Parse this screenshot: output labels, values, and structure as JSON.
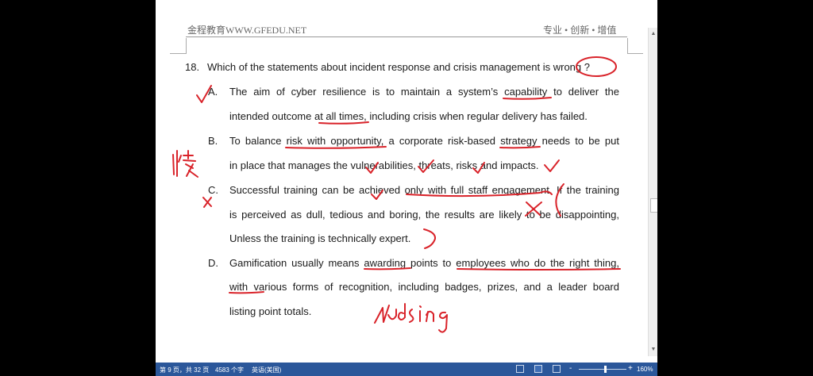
{
  "header": {
    "left": "金程教育WWW.GFEDU.NET",
    "right": "专业 • 创新 • 增值"
  },
  "question": {
    "number": "18.",
    "text": "Which of the statements about incident response and crisis management is wrong ?"
  },
  "options": [
    {
      "letter": "A.",
      "lines": [
        "The aim of cyber resilience is to maintain a system’s capability to deliver the",
        "intended outcome at all times, including crisis when regular delivery has failed."
      ]
    },
    {
      "letter": "B.",
      "lines": [
        "To balance risk with opportunity, a corporate risk-based strategy needs to be put",
        "in place that manages the vulnerabilities, threats, risks and impacts."
      ]
    },
    {
      "letter": "C.",
      "lines": [
        "Successful training can be achieved only with full staff engagement. If the training",
        "is perceived as dull, tedious and boring, the results are likely to be disappointing,",
        "Unless the training is technically expert."
      ]
    },
    {
      "letter": "D.",
      "lines": [
        "Gamification usually means awarding points to employees who do the right thing,",
        "with various forms of recognition, including badges, prizes, and a leader board",
        "listing point totals."
      ]
    }
  ],
  "annotations": {
    "ink_color": "#d9232a",
    "handwritten_note_b": "恢复",
    "handwritten_note_d": "Nudging"
  },
  "status_bar": {
    "page": "第 9 页，共 32 页",
    "words": "4583 个字",
    "language": "英语(美国)",
    "zoom": "160%",
    "zoom_minus": "-",
    "zoom_plus": "+"
  }
}
